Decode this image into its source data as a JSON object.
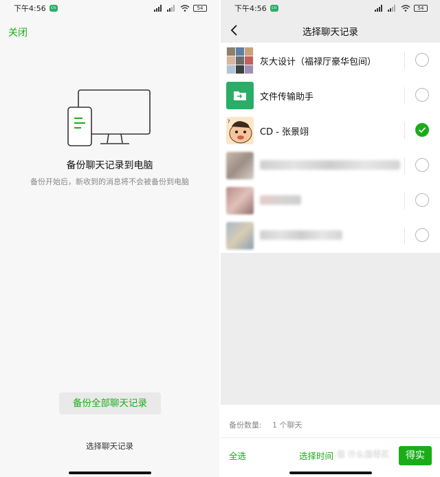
{
  "status_bar": {
    "time": "下午4:56",
    "badge": "cn",
    "battery": "54"
  },
  "left": {
    "close_label": "关闭",
    "title": "备份聊天记录到电脑",
    "subtitle": "备份开始后，新收到的消息将不会被备份到电脑",
    "backup_all_label": "备份全部聊天记录",
    "select_chats_label": "选择聊天记录"
  },
  "right": {
    "title": "选择聊天记录",
    "chats": [
      {
        "name": "灰大设计（福禄厅豪华包间）",
        "selected": false,
        "avatar": "group-collage"
      },
      {
        "name": "文件传输助手",
        "selected": false,
        "avatar": "folder-icon"
      },
      {
        "name": "CD - 张景翊",
        "selected": true,
        "avatar": "cartoon-face"
      },
      {
        "name": "",
        "selected": false,
        "avatar": "blurred"
      },
      {
        "name": "",
        "selected": false,
        "avatar": "blurred"
      },
      {
        "name": "",
        "selected": false,
        "avatar": "blurred"
      }
    ],
    "count_label": "备份数量:",
    "count_value": "1 个聊天",
    "select_all_label": "全选",
    "select_time_label": "选择时间",
    "done_label": "得实"
  },
  "watermark": "值 什么值得买",
  "colors": {
    "accent": "#1aad19",
    "background": "#ededed"
  }
}
